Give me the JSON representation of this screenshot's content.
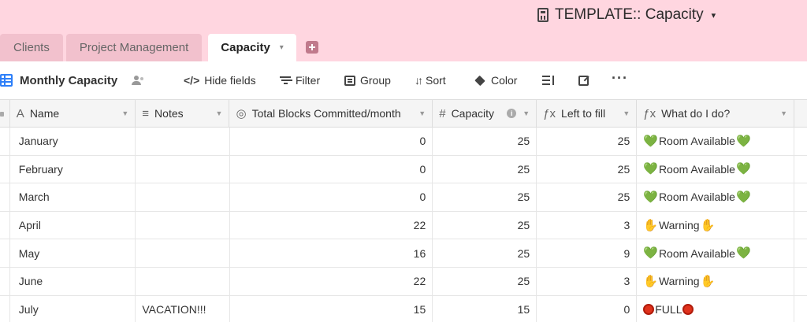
{
  "app": {
    "base_title": "TEMPLATE:: Capacity",
    "base_icon": "calculator-icon",
    "base_caret": "▾"
  },
  "tabs": [
    {
      "label": "Clients",
      "active": false
    },
    {
      "label": "Project Management",
      "active": false
    },
    {
      "label": "Capacity",
      "active": true,
      "caret": "▾"
    }
  ],
  "toolbar": {
    "view_name": "Monthly Capacity",
    "hide_fields": "Hide fields",
    "filter": "Filter",
    "group": "Group",
    "sort": "Sort",
    "color": "Color",
    "more": "···"
  },
  "columns": [
    {
      "name": "Name",
      "icon": "A"
    },
    {
      "name": "Notes",
      "icon": "≡"
    },
    {
      "name": "Total Blocks Committed/month",
      "icon": "◎"
    },
    {
      "name": "Capacity",
      "icon": "#",
      "info": "i"
    },
    {
      "name": "Left to fill",
      "icon": "ƒx"
    },
    {
      "name": "What do I do?",
      "icon": "ƒx"
    }
  ],
  "rows": [
    {
      "name": "January",
      "notes": "",
      "committed": "0",
      "capacity": "25",
      "left": "25",
      "status_text": "Room Available",
      "status_type": "heart"
    },
    {
      "name": "February",
      "notes": "",
      "committed": "0",
      "capacity": "25",
      "left": "25",
      "status_text": "Room Available",
      "status_type": "heart"
    },
    {
      "name": "March",
      "notes": "",
      "committed": "0",
      "capacity": "25",
      "left": "25",
      "status_text": "Room Available",
      "status_type": "heart"
    },
    {
      "name": "April",
      "notes": "",
      "committed": "22",
      "capacity": "25",
      "left": "3",
      "status_text": "Warning",
      "status_type": "hand"
    },
    {
      "name": "May",
      "notes": "",
      "committed": "16",
      "capacity": "25",
      "left": "9",
      "status_text": "Room Available",
      "status_type": "heart"
    },
    {
      "name": "June",
      "notes": "",
      "committed": "22",
      "capacity": "25",
      "left": "3",
      "status_text": "Warning",
      "status_type": "hand"
    },
    {
      "name": "July",
      "notes": "VACATION!!!",
      "committed": "15",
      "capacity": "15",
      "left": "0",
      "status_text": "FULL",
      "status_type": "stop"
    }
  ],
  "colors": {
    "top_band": "#ffd6e0",
    "inactive_tab": "#f2c1cd",
    "view_icon": "#2d7ff9",
    "heart": "#2eb82e",
    "stop": "#e0321c"
  }
}
